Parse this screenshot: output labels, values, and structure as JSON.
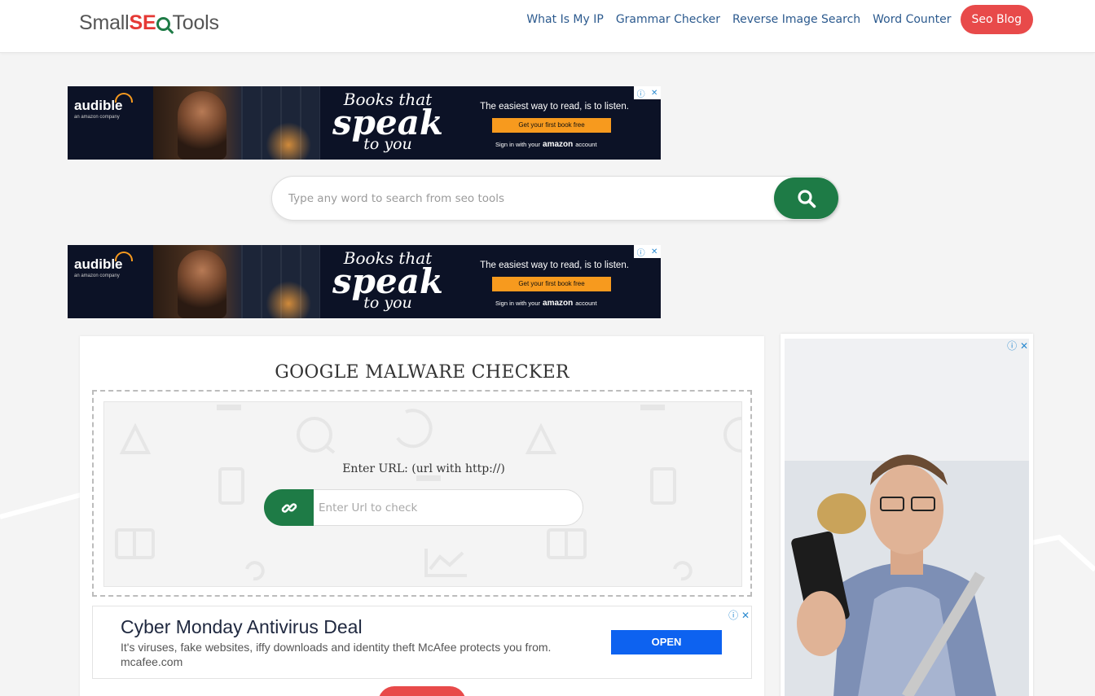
{
  "header": {
    "logo": {
      "part1": "Small",
      "part2": "SE",
      "part3": "Tools"
    },
    "nav": [
      {
        "label": "What Is My IP"
      },
      {
        "label": "Grammar Checker"
      },
      {
        "label": "Reverse Image Search"
      },
      {
        "label": "Word Counter"
      },
      {
        "label": "Seo Blog"
      }
    ]
  },
  "banner_ad": {
    "brand": "audible",
    "brand_sub": "an amazon company",
    "headline_1": "Books that",
    "headline_2": "speak",
    "headline_3": "to you",
    "tagline": "The easiest way to read, is to listen.",
    "cta": "Get your first book free",
    "signin_1": "Sign in with your",
    "signin_brand": "amazon",
    "signin_2": "account"
  },
  "search": {
    "placeholder": "Type any word to search from seo tools",
    "value": ""
  },
  "tool": {
    "title": "GOOGLE MALWARE CHECKER",
    "url_label": "Enter URL: (url with http://)",
    "url_placeholder": "Enter Url to check"
  },
  "text_ad": {
    "title": "Cyber Monday Antivirus Deal",
    "description": "It's viruses, fake websites, iffy downloads and identity theft McAfee protects you from.",
    "url": "mcafee.com",
    "button": "OPEN"
  },
  "colors": {
    "brand_green": "#1e7b46",
    "brand_red": "#e84a4a",
    "nav_blue": "#2c5a8e",
    "open_blue": "#0d62f0"
  },
  "icons": [
    "search-icon",
    "link-icon",
    "adchoices-icon",
    "close-icon"
  ]
}
